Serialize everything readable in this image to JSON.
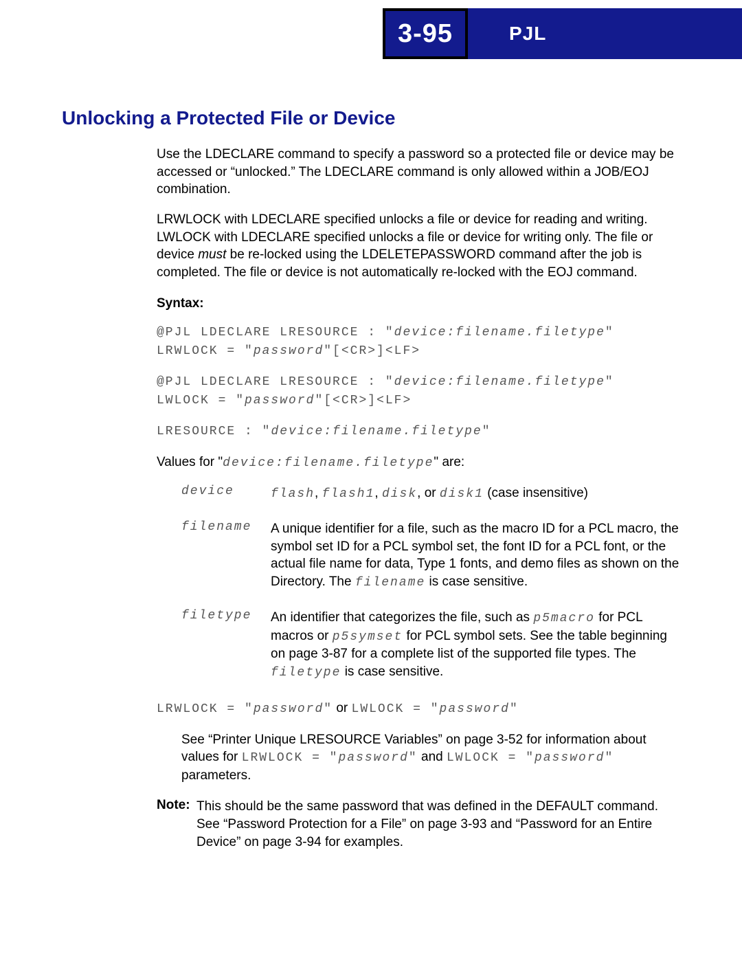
{
  "header": {
    "page_number": "3-95",
    "doc_code": "PJL"
  },
  "title": "Unlocking a Protected File or Device",
  "para1": "Use the LDECLARE command to specify a password so a protected file or device may be accessed or “unlocked.” The LDECLARE command is only allowed within a JOB/EOJ combination.",
  "para2_a": "LRWLOCK with LDECLARE specified unlocks a file or device for reading and writing. LWLOCK with LDECLARE specified unlocks a file or device for writing only. The file or device ",
  "para2_must": "must",
  "para2_b": " be re-locked using the LDELETEPASSWORD command after the job is completed. The file or device is not automatically re-locked with the EOJ command.",
  "syntax_label": "Syntax:",
  "syntax1": {
    "l1a": "@PJL LDECLARE LRESOURCE : \"",
    "l1b": "device:filename.filetype",
    "l1c": "\"",
    "l2a": "LRWLOCK = \"",
    "l2b": "password",
    "l2c": "\"[<CR>]<LF>"
  },
  "syntax2": {
    "l1a": "@PJL LDECLARE LRESOURCE : \"",
    "l1b": "device:filename.filetype",
    "l1c": "\"",
    "l2a": "LWLOCK = \"",
    "l2b": "password",
    "l2c": "\"[<CR>]<LF>"
  },
  "syntax3": {
    "a": "LRESOURCE : \"",
    "b": "device:filename.filetype",
    "c": "\""
  },
  "values_for_a": "Values for \"",
  "values_for_code": "device:filename.filetype",
  "values_for_b": "\" are:",
  "dl": {
    "device": {
      "term": "device",
      "v1": "flash",
      "sep": ", ",
      "v2": "flash1",
      "v3": "disk",
      "or": ", or ",
      "v4": "disk1",
      "tail": " (case insensitive)"
    },
    "filename": {
      "term": "filename",
      "a": "A unique identifier for a file, such as the macro ID for a PCL macro, the symbol set ID for a PCL symbol set, the font ID for a PCL font, or the actual file name for data, Type 1 fonts, and demo files as shown on the Directory. The ",
      "code": "filename",
      "b": " is case sensitive."
    },
    "filetype": {
      "term": "filetype",
      "a": "An identifier that categorizes the file, such as ",
      "code1": "p5macro",
      "b": " for PCL macros or ",
      "code2": "p5symset",
      "c": " for PCL symbol sets. See the table beginning on page 3-87 for a complete list of the supported file types. The ",
      "code3": "filetype",
      "d": " is case sensitive."
    }
  },
  "lock_line": {
    "a": "LRWLOCK = \"",
    "b": "password",
    "c": "\"",
    "or": " or ",
    "d": "LWLOCK = \"",
    "e": "password",
    "f": "\""
  },
  "see_para": {
    "a": "See “Printer Unique LRESOURCE Variables” on page 3-52 for information about values for ",
    "c1a": "LRWLOCK = \"",
    "c1b": "password",
    "c1c": "\"",
    "and": " and ",
    "c2a": "LWLOCK = \"",
    "c2b": "password",
    "c2c": "\"",
    "tail": " parameters."
  },
  "note": {
    "label": "Note:",
    "body": "This should be the same password that was defined in the DEFAULT command. See “Password Protection for a File” on page 3-93 and “Password for an Entire Device” on page 3-94 for examples."
  }
}
